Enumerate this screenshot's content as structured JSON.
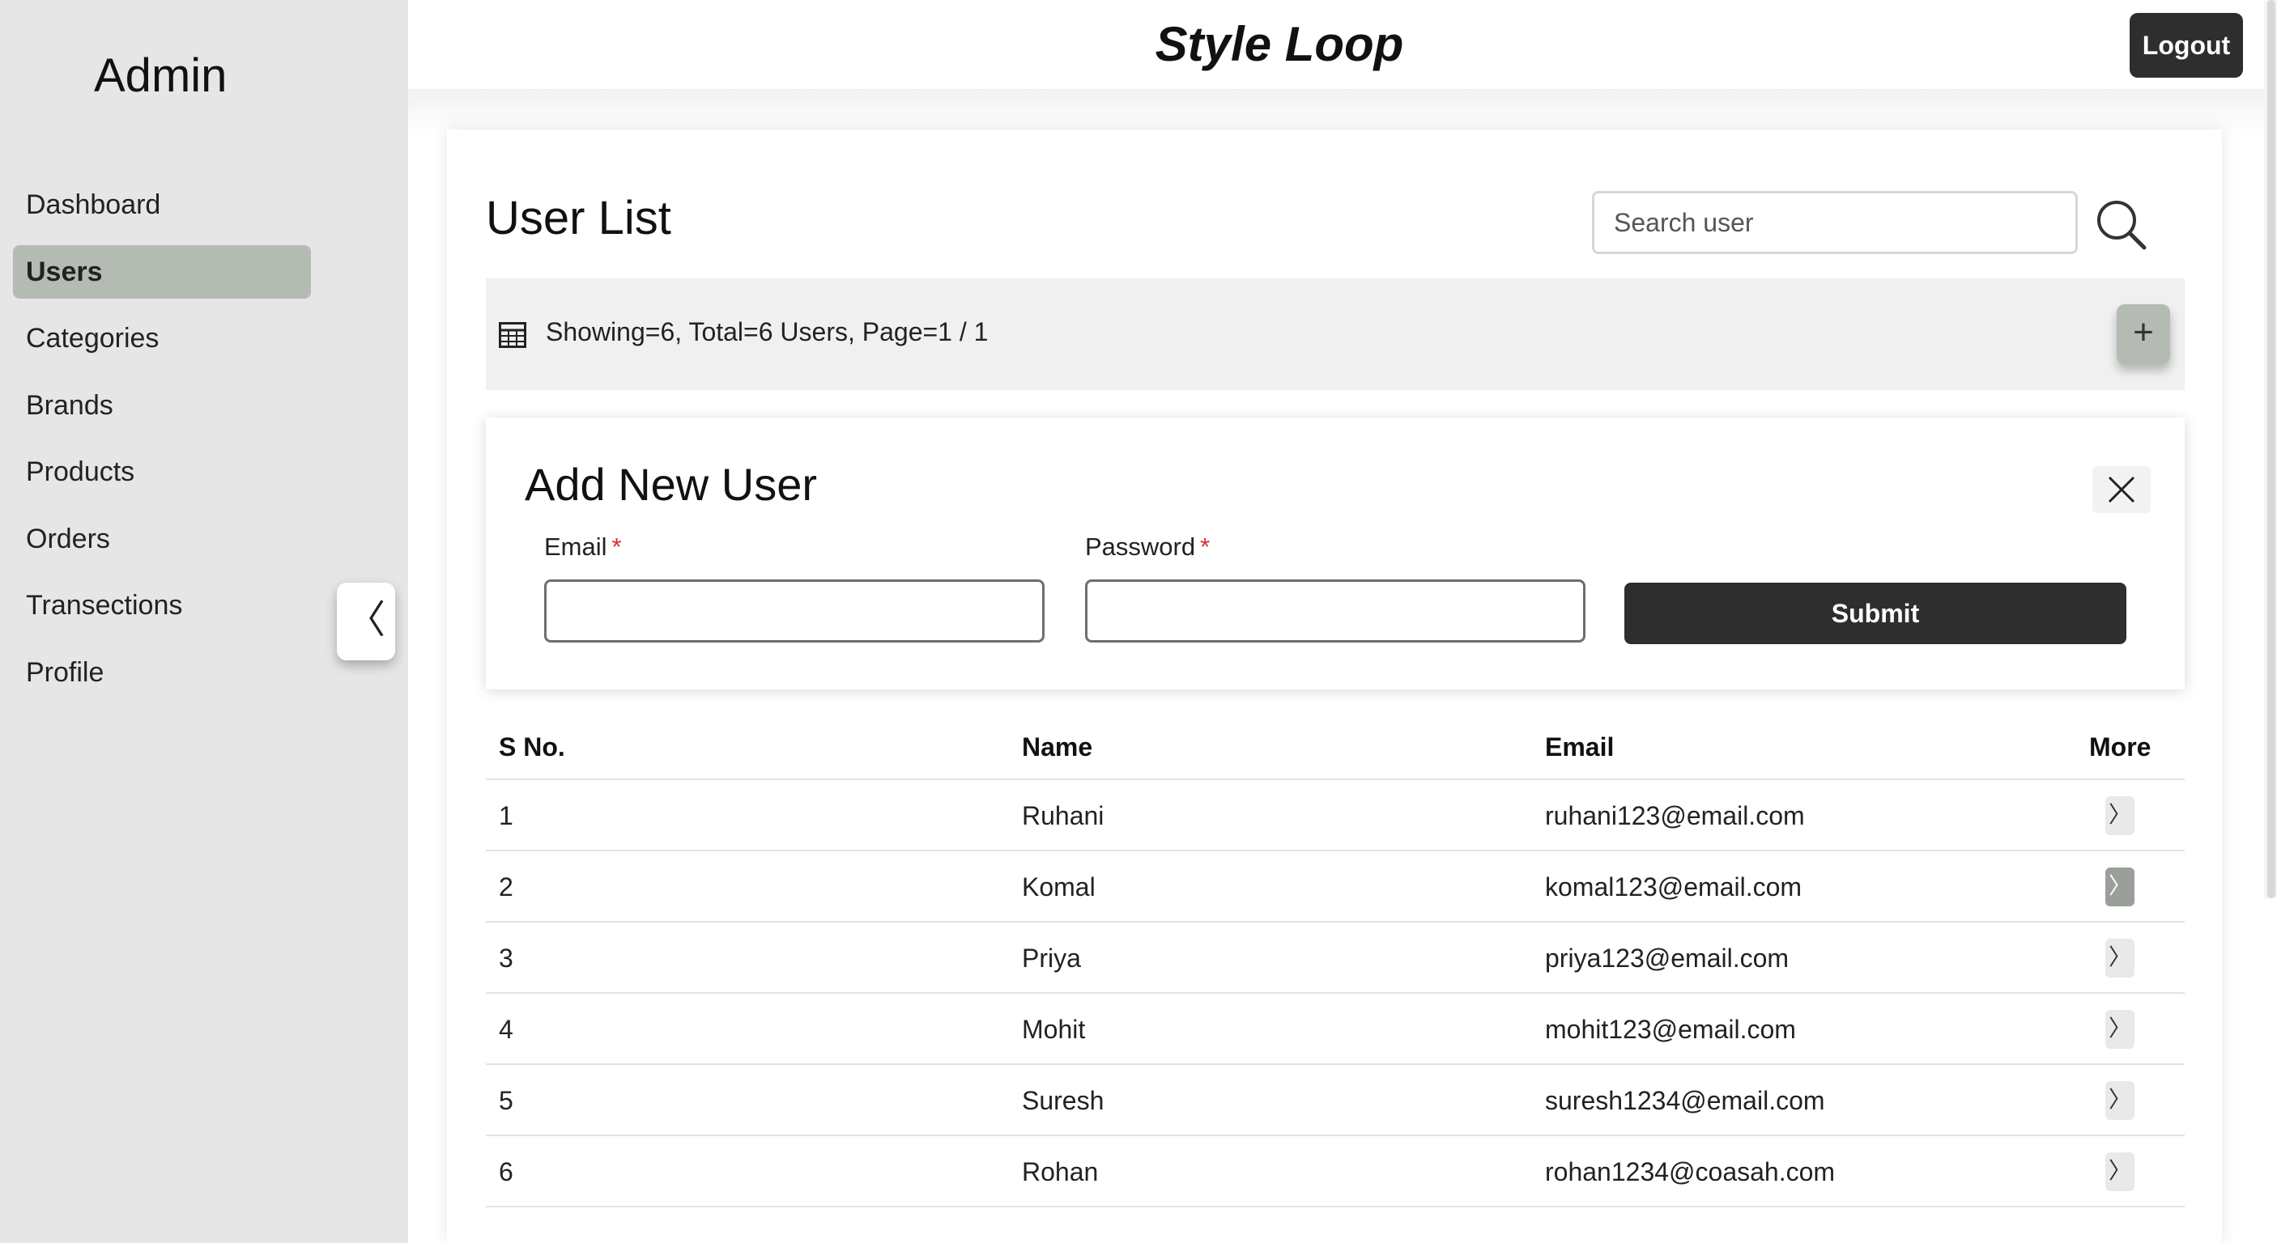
{
  "sidebar": {
    "title": "Admin",
    "items": [
      {
        "label": "Dashboard",
        "active": false
      },
      {
        "label": "Users",
        "active": true
      },
      {
        "label": "Categories",
        "active": false
      },
      {
        "label": "Brands",
        "active": false
      },
      {
        "label": "Products",
        "active": false
      },
      {
        "label": "Orders",
        "active": false
      },
      {
        "label": "Transections",
        "active": false
      },
      {
        "label": "Profile",
        "active": false
      }
    ],
    "collapse_icon": "chevron-left-icon"
  },
  "header": {
    "brand": "Style Loop",
    "logout_label": "Logout"
  },
  "main": {
    "title": "User List",
    "search": {
      "placeholder": "Search user",
      "value": "",
      "icon": "search-icon"
    },
    "info_text": "Showing=6, Total=6 Users, Page=1 / 1",
    "add_button_label": "+"
  },
  "add_user": {
    "title": "Add New User",
    "email_label": "Email",
    "password_label": "Password",
    "required_mark": "*",
    "email_value": "",
    "password_value": "",
    "submit_label": "Submit"
  },
  "table": {
    "headers": [
      "S No.",
      "Name",
      "Email",
      "More"
    ],
    "rows": [
      {
        "sno": "1",
        "name": "Ruhani",
        "email": "ruhani123@email.com"
      },
      {
        "sno": "2",
        "name": "Komal",
        "email": "komal123@email.com"
      },
      {
        "sno": "3",
        "name": "Priya",
        "email": "priya123@email.com"
      },
      {
        "sno": "4",
        "name": "Mohit",
        "email": "mohit123@email.com"
      },
      {
        "sno": "5",
        "name": "Suresh",
        "email": "suresh1234@email.com"
      },
      {
        "sno": "6",
        "name": "Rohan",
        "email": "rohan1234@coasah.com"
      }
    ],
    "more_glyph": "〉"
  },
  "colors": {
    "sidebar_bg": "#e6e6e6",
    "active_item": "#b3bbb2",
    "dark_button": "#2e2e2e",
    "required": "#d93030"
  }
}
